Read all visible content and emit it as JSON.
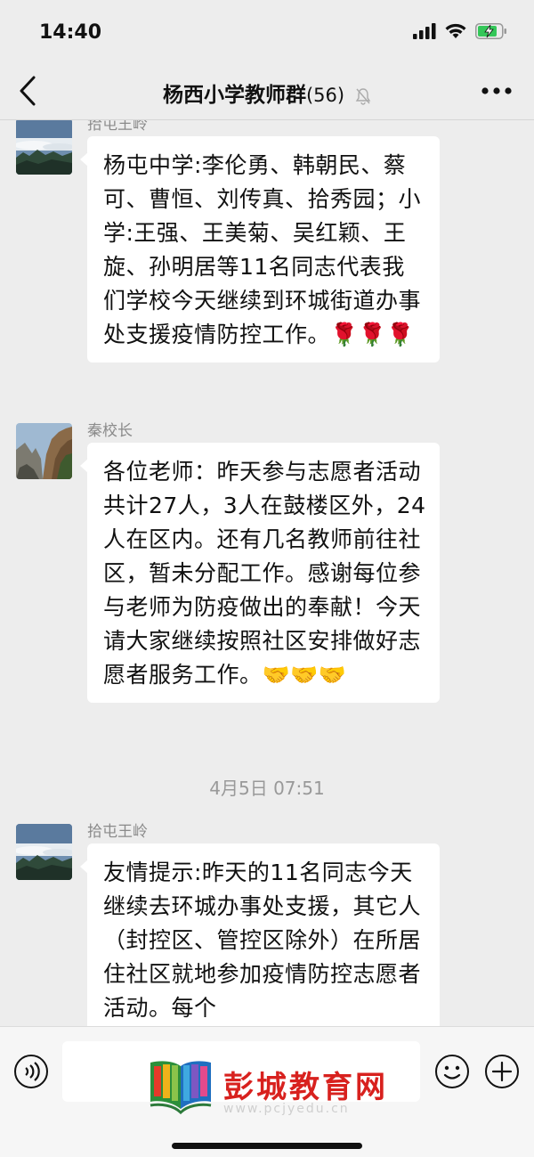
{
  "status_bar": {
    "time": "14:40"
  },
  "nav": {
    "title": "杨西小学教师群",
    "member_count": "(56)"
  },
  "messages": [
    {
      "sender": "拾屯王岭",
      "text": "杨屯中学:李伦勇、韩朝民、蔡可、曹恒、刘传真、拾秀园；小学:王强、王美菊、吴红颖、王旋、孙明居等11名同志代表我们学校今天继续到环城街道办事处支援疫情防控工作。🌹🌹🌹"
    },
    {
      "sender": "秦校长",
      "text": "各位老师：昨天参与志愿者活动共计27人，3人在鼓楼区外，24人在区内。还有几名教师前往社区，暂未分配工作。感谢每位参与老师为防疫做出的奉献！今天请大家继续按照社区安排做好志愿者服务工作。🤝🤝🤝"
    },
    {
      "sender": "拾屯王岭",
      "text": "友情提示:昨天的11名同志今天继续去环城办事处支援，其它人（封控区、管控区除外）在所居住社区就地参加疫情防控志愿者活动。每个"
    }
  ],
  "timestamp": "4月5日 07:51",
  "watermark": {
    "name": "彭城教育网",
    "url": "www.pcjyedu.cn"
  },
  "icons": {
    "back": "chevron-left-icon",
    "mute": "bell-off-icon",
    "more": "more-icon",
    "voice": "voice-icon",
    "emoji": "emoji-icon",
    "plus": "plus-icon"
  },
  "colors": {
    "background": "#ededed",
    "bubble": "#ffffff",
    "watermark_red": "#d8211e"
  }
}
